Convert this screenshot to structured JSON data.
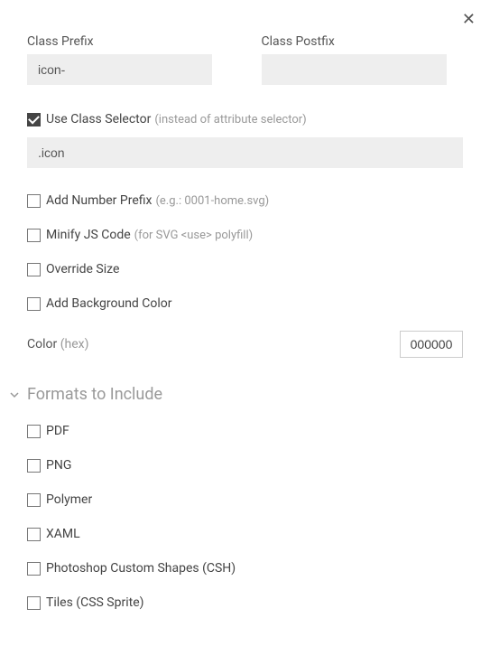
{
  "close_label": "✕",
  "prefix": {
    "label": "Class Prefix",
    "value": "icon-"
  },
  "postfix": {
    "label": "Class Postfix",
    "value": ""
  },
  "useClassSelector": {
    "label": "Use Class Selector",
    "hint": "(instead of attribute selector)",
    "checked": true,
    "value": ".icon"
  },
  "addNumberPrefix": {
    "label": "Add Number Prefix",
    "hint": "(e.g.: 0001-home.svg)",
    "checked": false
  },
  "minifyJs": {
    "label": "Minify JS Code",
    "hint": "(for SVG <use> polyfill)",
    "checked": false
  },
  "overrideSize": {
    "label": "Override Size",
    "checked": false
  },
  "addBgColor": {
    "label": "Add Background Color",
    "checked": false
  },
  "color": {
    "label": "Color",
    "hint": "(hex)",
    "value": "000000"
  },
  "formatsSection": {
    "title": "Formats to Include"
  },
  "formats": {
    "pdf": {
      "label": "PDF",
      "checked": false
    },
    "png": {
      "label": "PNG",
      "checked": false
    },
    "polymer": {
      "label": "Polymer",
      "checked": false
    },
    "xaml": {
      "label": "XAML",
      "checked": false
    },
    "csh": {
      "label": "Photoshop Custom Shapes (CSH)",
      "checked": false
    },
    "tiles": {
      "label": "Tiles (CSS Sprite)",
      "checked": false
    }
  }
}
